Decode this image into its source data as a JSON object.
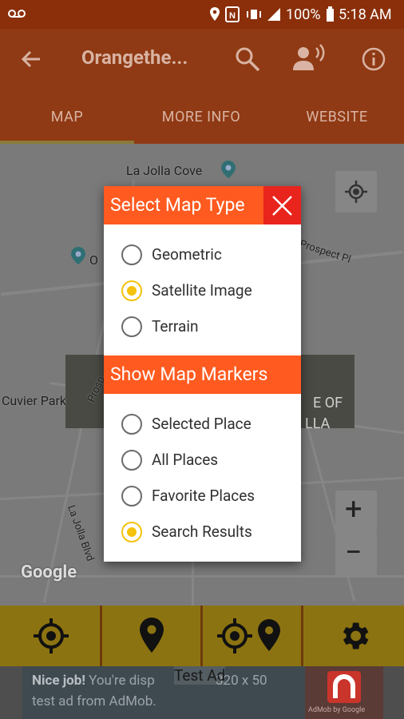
{
  "status_bar": {
    "battery": "100%",
    "time": "5:18 AM"
  },
  "app_bar": {
    "title": "Orangethe..."
  },
  "tabs": [
    {
      "label": "MAP",
      "selected": true
    },
    {
      "label": "MORE INFO",
      "selected": false
    },
    {
      "label": "WEBSITE",
      "selected": false
    }
  ],
  "map": {
    "labels": {
      "la_jolla_cove": "La Jolla Cove",
      "cuvier_park": "Cuvier Park",
      "prospect_pl": "Prospect Pl",
      "la_jolla_blvd": "La Jolla Blvd",
      "of": "E OF",
      "lla": "LLA",
      "oc": "O",
      "prosp": "Prosp",
      "google": "Google"
    },
    "zoom_in": "+",
    "zoom_out": "−"
  },
  "dialog": {
    "map_type_title": "Select Map Type",
    "map_types": [
      {
        "label": "Geometric",
        "selected": false
      },
      {
        "label": "Satellite Image",
        "selected": true
      },
      {
        "label": "Terrain",
        "selected": false
      }
    ],
    "markers_title": "Show Map Markers",
    "markers": [
      {
        "label": "Selected Place",
        "selected": false
      },
      {
        "label": "All Places",
        "selected": false
      },
      {
        "label": "Favorite Places",
        "selected": false
      },
      {
        "label": "Search Results",
        "selected": true
      }
    ]
  },
  "toolbar": {
    "buttons": [
      "crosshair-icon",
      "location-pin-icon",
      "crosshair-pin-icon",
      "settings-gear-icon"
    ]
  },
  "ad": {
    "test_label": "Test Ad",
    "line1_bold": "Nice job!",
    "line1": "You're disp",
    "line1_rest": "320 x 50",
    "line2": "test ad from AdMob.",
    "brand": "AdMob by Google"
  },
  "colors": {
    "accent_orange": "#ff5a1f",
    "close_red": "#e8241c",
    "radio_selected": "#f4c20d",
    "toolbar": "#8c7311"
  }
}
